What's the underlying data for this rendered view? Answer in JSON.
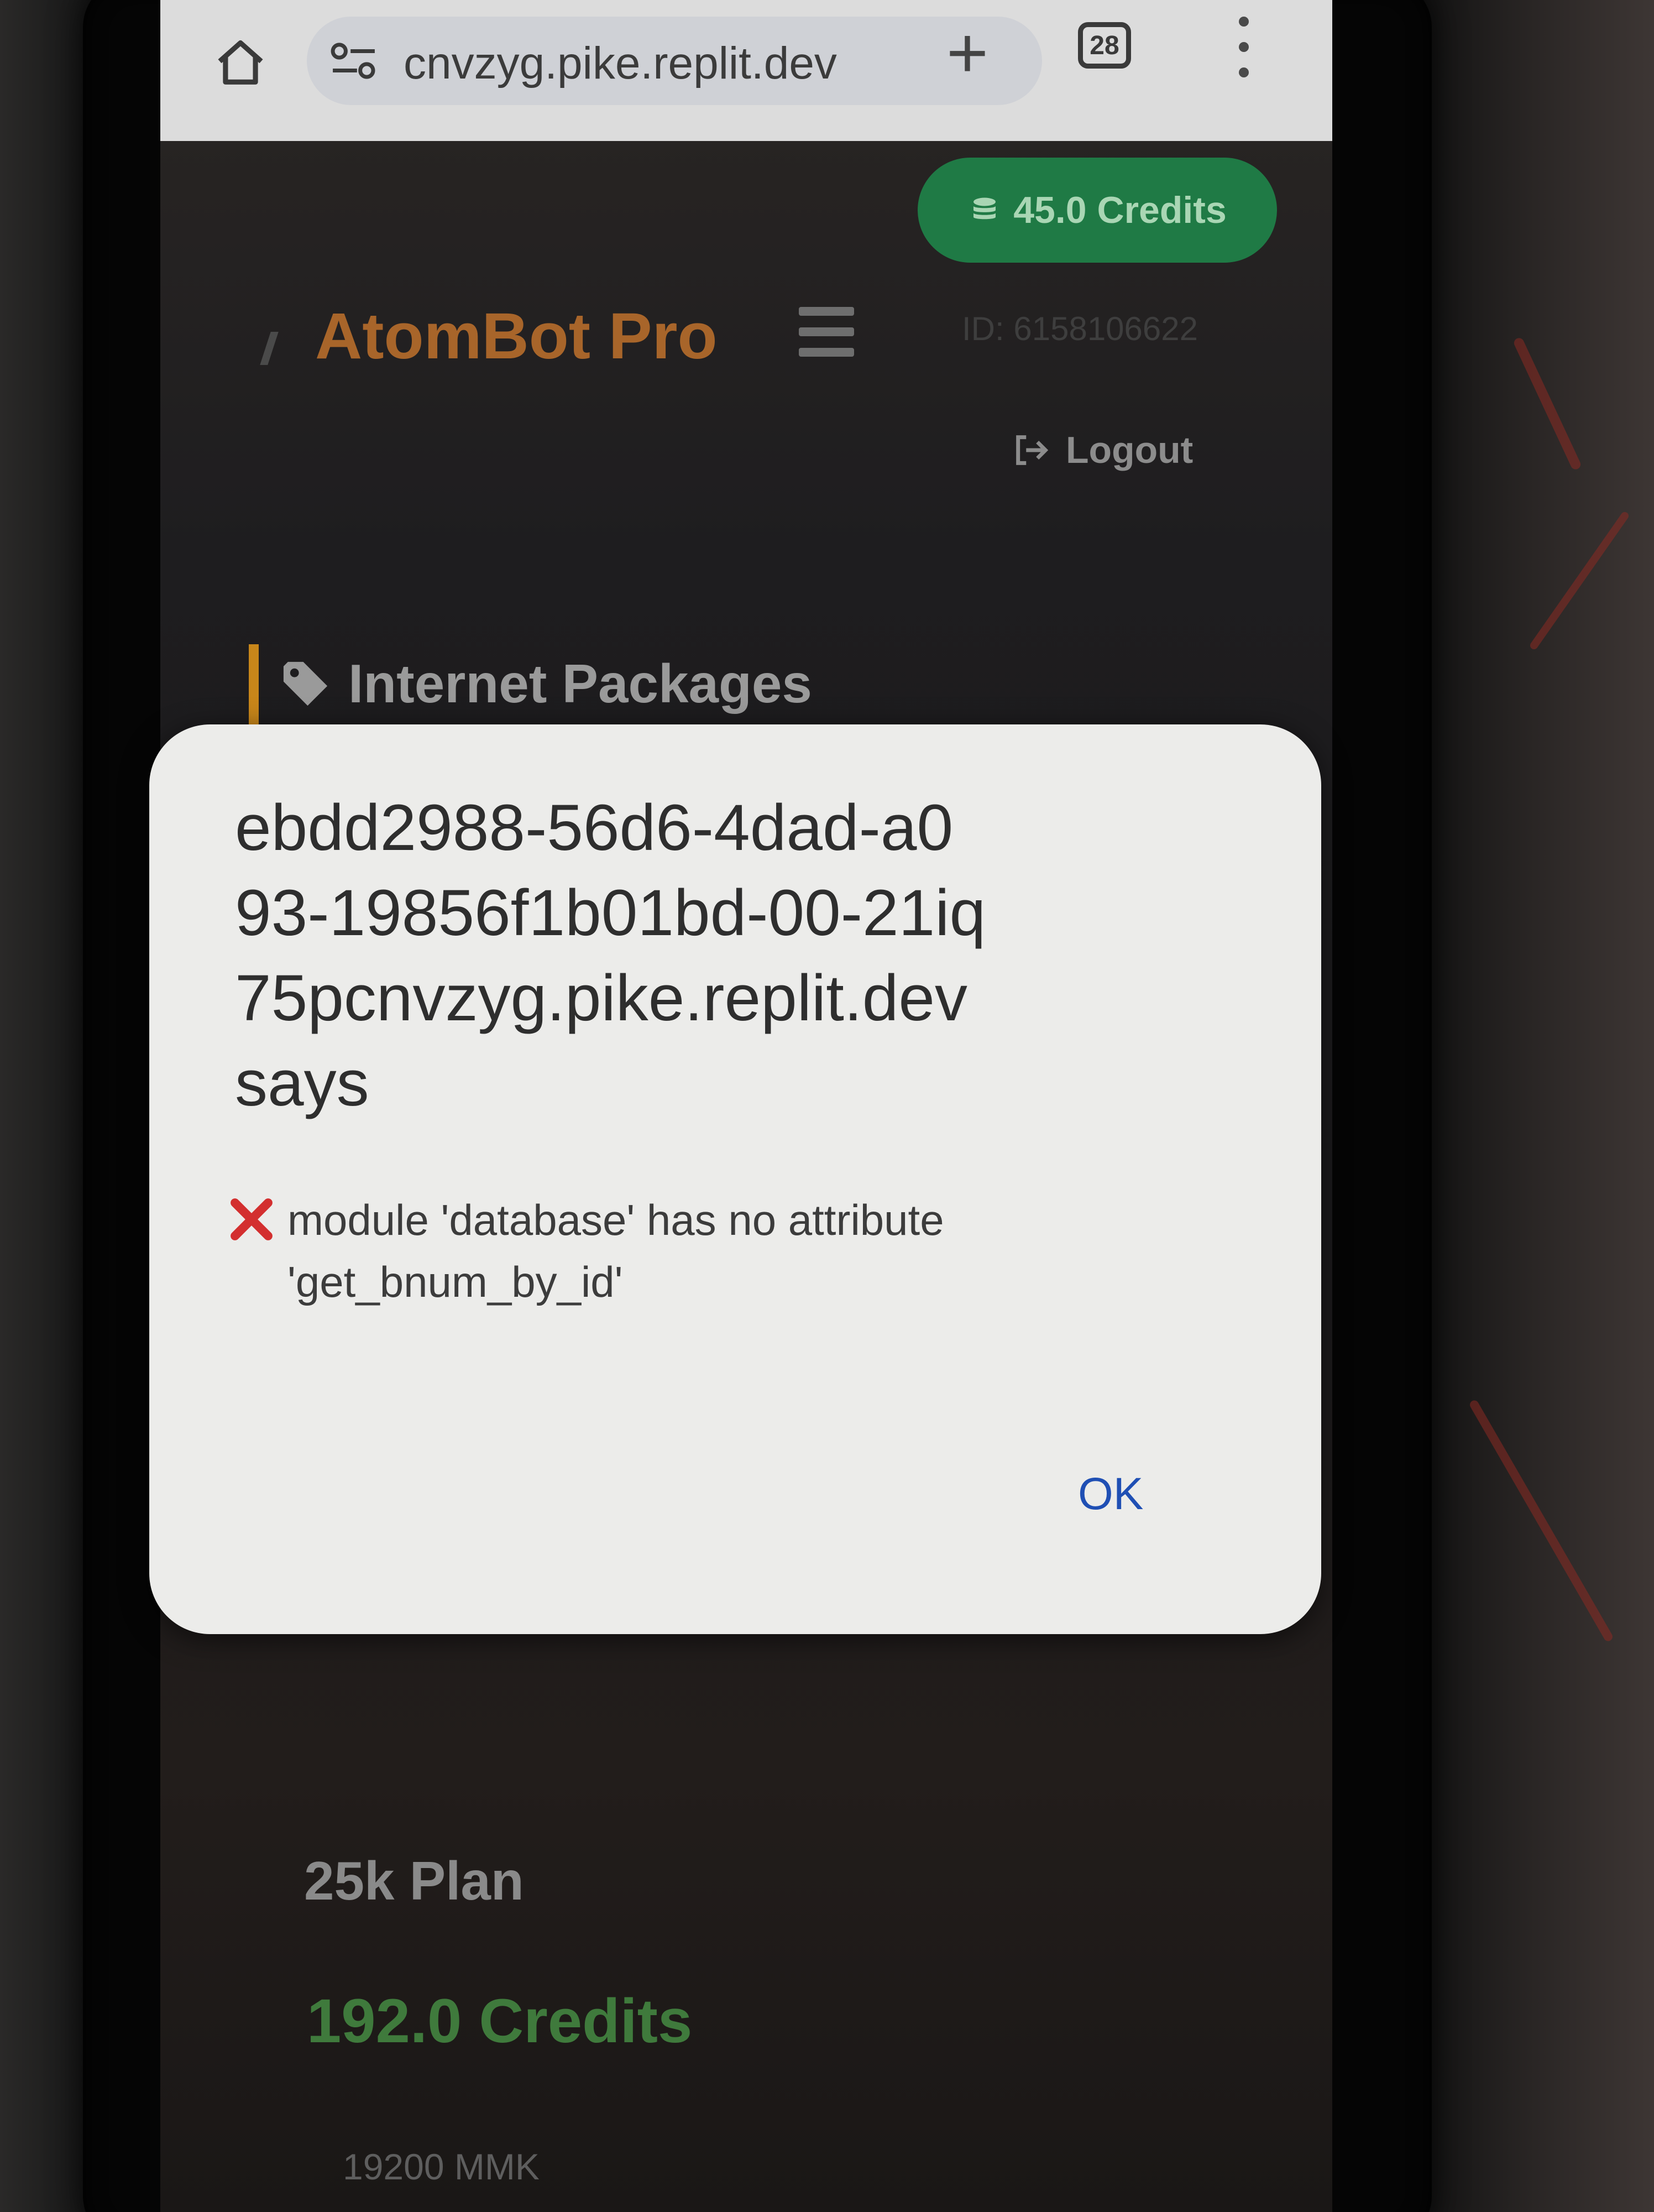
{
  "browser": {
    "url": "cnvzyg.pike.replit.dev",
    "tab_count": "28"
  },
  "page": {
    "credits_pill": "45.0 Credits",
    "brand": "AtomBot Pro",
    "user_id": "ID: 6158106622",
    "logout": "Logout",
    "section_title": "Internet Packages",
    "plan": {
      "title": "25k Plan",
      "credits": "192.0 Credits",
      "price": "19200 MMK"
    }
  },
  "dialog": {
    "title": "ebdd2988-56d6-4dad-a0\n93-19856f1b01bd-00-21iq\n75pcnvzyg.pike.replit.dev\nsays",
    "message": "module 'database' has no attribute 'get_bnum_by_id'",
    "ok_label": "OK"
  },
  "colors": {
    "dialog_bg": "#ececea",
    "ok_link": "#1f4fb4",
    "credits_green": "#1f7a45",
    "brand_orange": "#a8652a",
    "error_red": "#d32f2f"
  },
  "icons": [
    "home-icon",
    "site-settings-icon",
    "plus-icon",
    "tab-switcher-icon",
    "more-vert-icon",
    "coins-icon",
    "menu-icon",
    "logout-icon",
    "tag-icon",
    "error-x-icon"
  ]
}
